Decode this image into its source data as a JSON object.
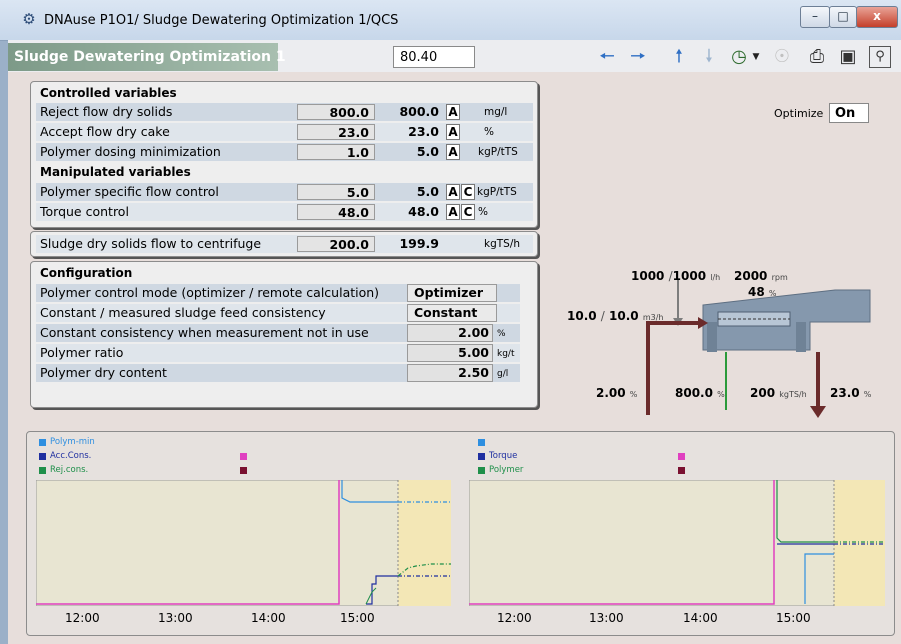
{
  "window": {
    "title": "DNAuse P1O1/ Sludge Dewatering Optimization 1/QCS",
    "minimize": "–",
    "maximize": "□",
    "close": "x"
  },
  "header": {
    "title": "Sludge Dewatering Optimization 1",
    "value": "80.40"
  },
  "toolbar_icons": [
    "arrow-left-icon",
    "arrow-right-icon",
    "arrow-up-icon",
    "arrow-down-icon",
    "clock-icon",
    "dropdown-arrow-icon",
    "gauge-icon",
    "print-icon",
    "camera-icon",
    "zoom-icon"
  ],
  "controlled": {
    "heading": "Controlled variables",
    "rows": [
      {
        "label": "Reject flow dry solids",
        "setpoint": "800.0",
        "actual": "800.0",
        "mode": "A",
        "unit": "mg/l"
      },
      {
        "label": "Accept flow dry cake",
        "setpoint": "23.0",
        "actual": "23.0",
        "mode": "A",
        "unit": "%"
      },
      {
        "label": "Polymer dosing minimization",
        "setpoint": "1.0",
        "actual": "5.0",
        "mode": "A",
        "unit": "kgP/tTS"
      }
    ]
  },
  "manipulated": {
    "heading": "Manipulated variables",
    "rows": [
      {
        "label": "Polymer specific flow control",
        "setpoint": "5.0",
        "actual": "5.0",
        "mode": "A",
        "mode2": "C",
        "unit": "kgP/tTS"
      },
      {
        "label": "Torque control",
        "setpoint": "48.0",
        "actual": "48.0",
        "mode": "A",
        "mode2": "C",
        "unit": "%"
      }
    ]
  },
  "sludge_flow": {
    "label": "Sludge dry solids flow to centrifuge",
    "setpoint": "200.0",
    "actual": "199.9",
    "unit": "kgTS/h"
  },
  "configuration": {
    "heading": "Configuration",
    "rows": [
      {
        "label": "Polymer control mode (optimizer / remote calculation)",
        "value": "Optimizer",
        "unit": ""
      },
      {
        "label": "Constant / measured sludge feed consistency",
        "value": "Constant",
        "unit": ""
      },
      {
        "label": "Constant consistency when measurement not in use",
        "value": "2.00",
        "unit": "%"
      },
      {
        "label": "Polymer ratio",
        "value": "5.00",
        "unit": "kg/t"
      },
      {
        "label": "Polymer dry content",
        "value": "2.50",
        "unit": "g/l"
      }
    ]
  },
  "optimize": {
    "label": "Optimize",
    "value": "On"
  },
  "diagram": {
    "polymer_flow": "1000",
    "polymer_flow_sp": "1000",
    "polymer_unit": "l/h",
    "sep": "/",
    "speed": "2000",
    "speed_unit": "rpm",
    "torque": "48",
    "torque_unit": "%",
    "feed_flow": "10.0",
    "feed_flow_sp": "10.0",
    "feed_unit": "m3/h",
    "consistency": "2.00",
    "consistency_unit": "%",
    "reject": "800.0",
    "reject_unit": "%",
    "solids_flow": "200",
    "solids_unit": "kgTS/h",
    "cake": "23.0",
    "cake_unit": "%",
    "colors": {
      "pipe": "#6b2b2b",
      "centrifuge": "#8598ad",
      "green": "#2b9a3a"
    }
  },
  "trend_left": {
    "legend": [
      {
        "name": "Polym-min",
        "color": "#2e8fe0"
      },
      {
        "name": "Acc.Cons.",
        "color": "#1f2fa0"
      },
      {
        "name": "Rej.cons.",
        "color": "#1f8f4a"
      }
    ],
    "legend_right_colors": [
      "#e040c0",
      "#7a1030"
    ],
    "ticks": [
      "12:00",
      "13:00",
      "14:00",
      "15:00"
    ]
  },
  "trend_right": {
    "legend_top_color": "#2e8fe0",
    "legend": [
      {
        "name": "Torque",
        "color": "#1f2fa0"
      },
      {
        "name": "Polymer",
        "color": "#1f8f4a"
      }
    ],
    "legend_right_colors": [
      "#e040c0",
      "#7a1030"
    ],
    "ticks": [
      "12:00",
      "13:00",
      "14:00",
      "15:00"
    ]
  }
}
